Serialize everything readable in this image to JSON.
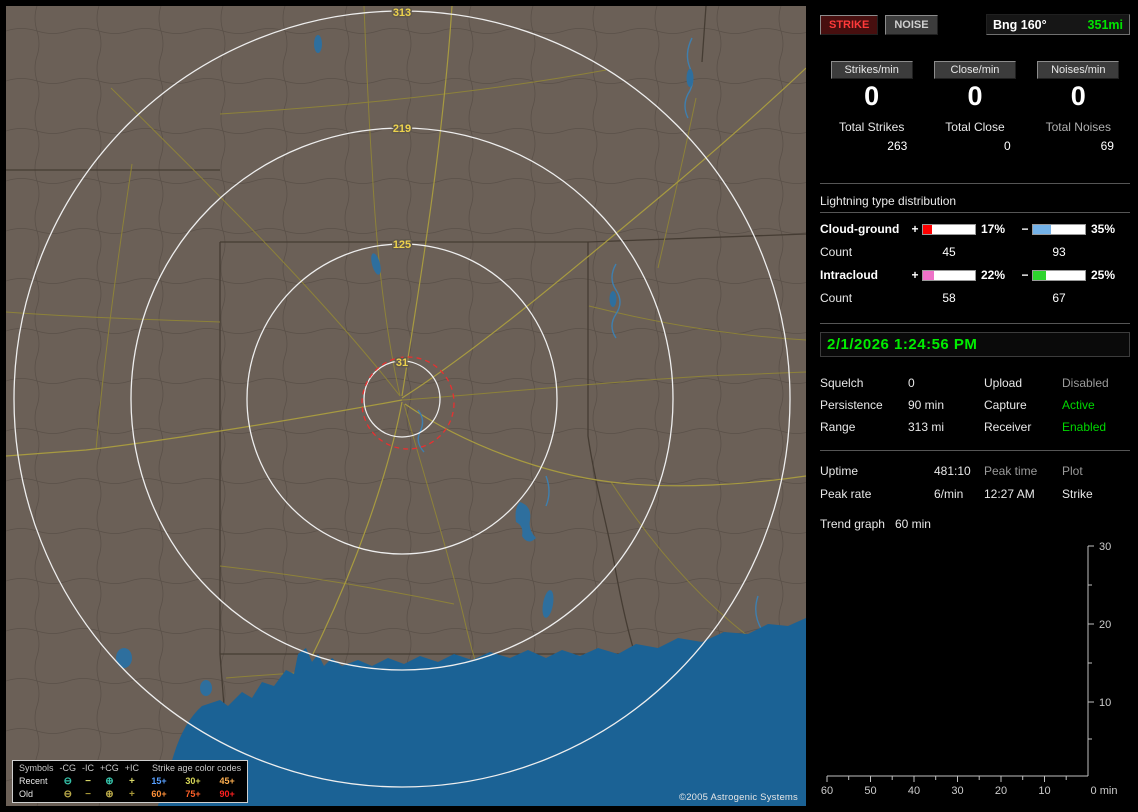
{
  "toolbar": {
    "strike": "STRIKE",
    "noise": "NOISE",
    "bearing_label": "Bng 160°",
    "bearing_value": "351mi"
  },
  "stats": {
    "columns": [
      {
        "header": "Strikes/min",
        "rate": "0",
        "total_label": "Total Strikes",
        "total_value": "263"
      },
      {
        "header": "Close/min",
        "rate": "0",
        "total_label": "Total Close",
        "total_value": "0"
      },
      {
        "header": "Noises/min",
        "rate": "0",
        "total_label": "Total Noises",
        "total_value": "69"
      }
    ]
  },
  "distribution": {
    "title": "Lightning type distribution",
    "cloud_ground": {
      "label": "Cloud-ground",
      "pos_sign": "+",
      "pos_pct": "17%",
      "pos_width": "17%",
      "pos_color": "#ff0000",
      "neg_sign": "−",
      "neg_pct": "35%",
      "neg_width": "35%",
      "neg_color": "#74b2e8",
      "count_label": "Count",
      "pos_count": "45",
      "neg_count": "93"
    },
    "intracloud": {
      "label": "Intracloud",
      "pos_sign": "+",
      "pos_pct": "22%",
      "pos_width": "22%",
      "pos_color": "#ee72c8",
      "neg_sign": "−",
      "neg_pct": "25%",
      "neg_width": "25%",
      "neg_color": "#2ed42e",
      "count_label": "Count",
      "pos_count": "58",
      "neg_count": "67"
    }
  },
  "clock": {
    "datetime": "2/1/2026 1:24:56 PM",
    "color": "#00ee00"
  },
  "settings": {
    "rows": [
      {
        "label1": "Squelch",
        "value1": "0",
        "label2": "Upload",
        "value2": "Disabled",
        "value2_color": "#9a9a9a"
      },
      {
        "label1": "Persistence",
        "value1": "90 min",
        "label2": "Capture",
        "value2": "Active",
        "value2_color": "#00d800"
      },
      {
        "label1": "Range",
        "value1": "313 mi",
        "label2": "Receiver",
        "value2": "Enabled",
        "value2_color": "#00d800"
      }
    ]
  },
  "status": {
    "uptime_label": "Uptime",
    "uptime_value": "481:10",
    "peak_time_label": "Peak time",
    "plot_label": "Plot",
    "peak_rate_label": "Peak rate",
    "peak_rate_value": "6/min",
    "peak_time_value": "12:27 AM",
    "plot_value": "Strike",
    "trend_label": "Trend graph",
    "trend_value": "60 min"
  },
  "graph": {
    "y_ticks": [
      "30",
      "20",
      "10"
    ],
    "x_ticks": [
      "60",
      "50",
      "40",
      "30",
      "20",
      "10"
    ],
    "x_end": "0 min"
  },
  "map": {
    "ring_labels": [
      "313",
      "219",
      "125",
      "31"
    ],
    "copyright": "©2005 Astrogenic Systems"
  },
  "legend": {
    "symbols_header": "Symbols",
    "symbol_columns": [
      "-CG",
      "-IC",
      "+CG",
      "+IC"
    ],
    "age_header": "Strike age color codes",
    "rows": [
      {
        "label": "Recent",
        "symbols": [
          {
            "glyph": "⊖",
            "color": "#35c0a8"
          },
          {
            "glyph": "−",
            "color": "#d8d868"
          },
          {
            "glyph": "⊕",
            "color": "#35c0a8"
          },
          {
            "glyph": "+",
            "color": "#d8d868"
          }
        ],
        "ages": [
          {
            "text": "15+",
            "color": "#58a0ff"
          },
          {
            "text": "30+",
            "color": "#d8d858"
          },
          {
            "text": "45+",
            "color": "#ffb050"
          }
        ]
      },
      {
        "label": "Old",
        "symbols": [
          {
            "glyph": "⊖",
            "color": "#b8a848"
          },
          {
            "glyph": "−",
            "color": "#a89838"
          },
          {
            "glyph": "⊕",
            "color": "#b8a848"
          },
          {
            "glyph": "+",
            "color": "#a89838"
          }
        ],
        "ages": [
          {
            "text": "60+",
            "color": "#ff9038"
          },
          {
            "text": "75+",
            "color": "#ff6028"
          },
          {
            "text": "90+",
            "color": "#ff2020"
          }
        ]
      }
    ]
  }
}
